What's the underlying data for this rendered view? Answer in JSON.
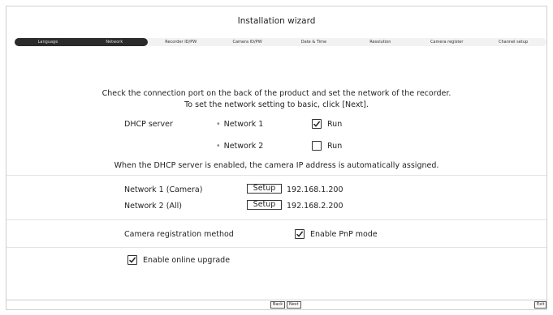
{
  "window": {
    "title": "Installation wizard"
  },
  "steps": [
    {
      "label": "Language",
      "active": true
    },
    {
      "label": "Network",
      "active": true
    },
    {
      "label": "Recorder ID/PW",
      "active": false
    },
    {
      "label": "Camera ID/PW",
      "active": false
    },
    {
      "label": "Date & Time",
      "active": false
    },
    {
      "label": "Resolution",
      "active": false
    },
    {
      "label": "Camera register",
      "active": false
    },
    {
      "label": "Channel setup",
      "active": false
    }
  ],
  "intro": {
    "line1": "Check the connection port on the back of the product and set the network of the recorder.",
    "line2": "To set the network setting to basic, click [Next]."
  },
  "dhcp": {
    "label": "DHCP server",
    "networks": [
      {
        "name": "Network 1",
        "checked": true,
        "option": "Run"
      },
      {
        "name": "Network 2",
        "checked": false,
        "option": "Run"
      }
    ],
    "note": "When the DHCP server is enabled, the camera IP address is automatically assigned."
  },
  "network_rows": [
    {
      "label": "Network 1 (Camera)",
      "button": "Setup",
      "ip": "192.168.1.200"
    },
    {
      "label": "Network 2 (All)",
      "button": "Setup",
      "ip": "192.168.2.200"
    }
  ],
  "registration": {
    "label": "Camera registration method",
    "option": "Enable PnP mode",
    "checked": true
  },
  "upgrade": {
    "option": "Enable online upgrade",
    "checked": true
  },
  "footer": {
    "back": "Back",
    "next": "Next",
    "exit": "Exit"
  }
}
